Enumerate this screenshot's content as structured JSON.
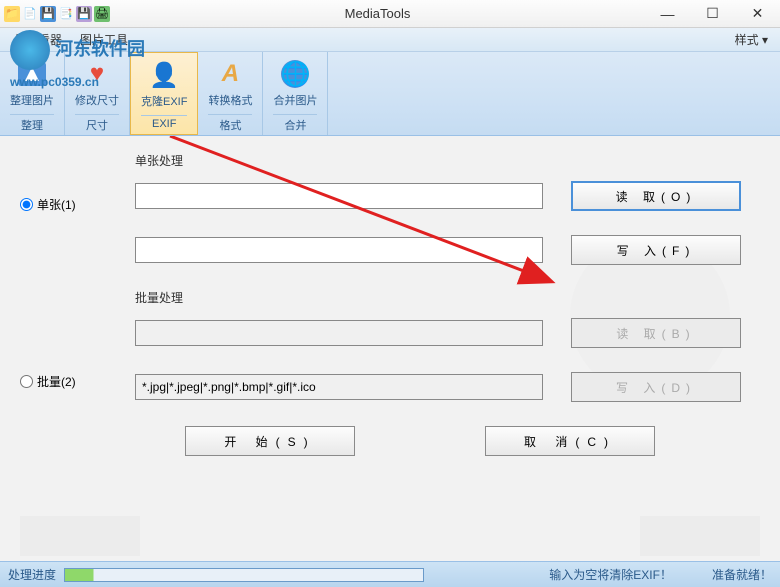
{
  "window": {
    "title": "MediaTools"
  },
  "menubar": {
    "viewer": "修查看器",
    "imageTools": "图片工具",
    "style": "样式 ▾"
  },
  "ribbon": {
    "organize": {
      "label": "整理图片",
      "footer": "整理"
    },
    "resize": {
      "label": "修改尺寸",
      "footer": "尺寸"
    },
    "cloneExif": {
      "label": "克隆EXIF",
      "footer": "EXIF"
    },
    "convert": {
      "label": "转换格式",
      "footer": "格式"
    },
    "merge": {
      "label": "合并图片",
      "footer": "合并"
    }
  },
  "form": {
    "singleSection": "单张处理",
    "batchSection": "批量处理",
    "radioSingle": "单张(1)",
    "radioBatch": "批量(2)",
    "readBtn": "读 取(O)",
    "writeBtn": "写 入(F)",
    "readBtn2": "读 取(B)",
    "writeBtn2": "写 入(D)",
    "startBtn": "开 始(S)",
    "cancelBtn": "取 消(C)",
    "filterValue": "*.jpg|*.jpeg|*.png|*.bmp|*.gif|*.ico"
  },
  "statusbar": {
    "progress": "处理进度",
    "hint": "输入为空将清除EXIF！",
    "ready": "准备就绪！"
  },
  "watermark": {
    "text": "河东软件园",
    "url": "www.pc0359.cn"
  }
}
